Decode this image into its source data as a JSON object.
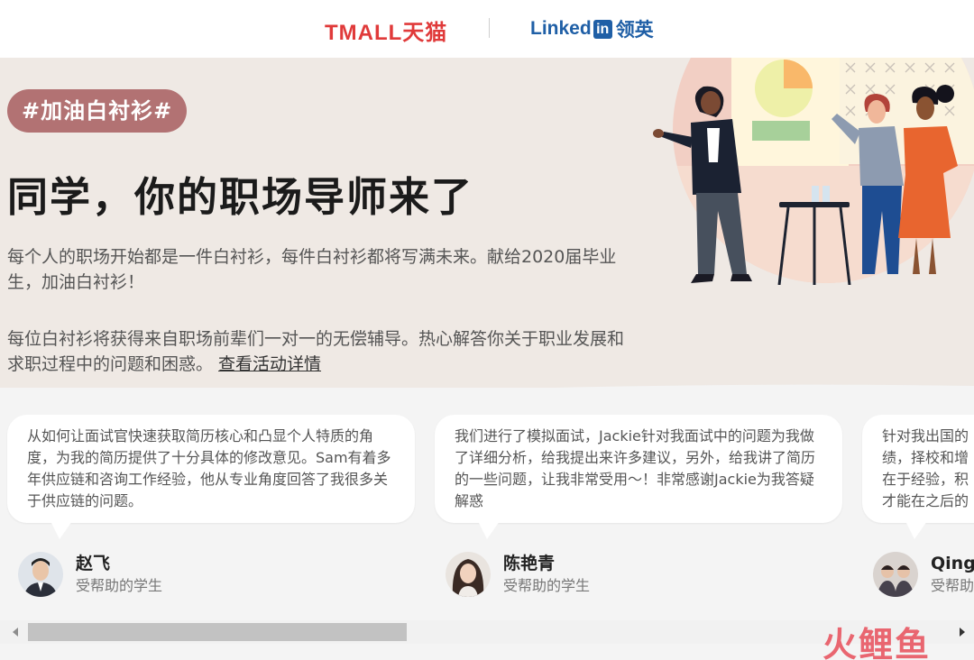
{
  "brand": {
    "tmall": "TMALL天猫",
    "linkedin_text": "Linked",
    "linkedin_in": "in",
    "linkedin_cn": "领英"
  },
  "hero": {
    "hashtag": "#加油白衬衫#",
    "headline": "同学，你的职场导师来了",
    "para1": "每个人的职场开始都是一件白衬衫，每件白衬衫都将写满未来。献给2020届毕业生，加油白衬衫！",
    "para2": "每位白衬衫将获得来自职场前辈们一对一的无偿辅导。热心解答你关于职业发展和求职过程中的问题和困惑。",
    "details_link": "查看活动详情"
  },
  "testimonials": [
    {
      "text": "从如何让面试官快速获取简历核心和凸显个人特质的角度，为我的简历提供了十分具体的修改意见。Sam有着多年供应链和咨询工作经验，他从专业角度回答了我很多关于供应链的问题。",
      "name": "赵飞",
      "role": "受帮助的学生"
    },
    {
      "text": "我们进行了模拟面试，Jackie针对我面试中的问题为我做了详细分析，给我提出来许多建议，另外，给我讲了简历的一些问题，让我非常受用～！非常感谢Jackie为我答疑解惑",
      "name": "陈艳青",
      "role": "受帮助的学生"
    },
    {
      "text": "针对我出国的\n绩，择校和增\n在于经验，积\n才能在之后的",
      "name": "Qingy",
      "role": "受帮助的"
    }
  ],
  "watermark": "火鲤鱼",
  "colors": {
    "tmall_red": "#e03a3a",
    "linkedin_blue": "#1f5fa6",
    "hashtag_bg": "#b27273",
    "hero_bg": "#efe9e4"
  }
}
